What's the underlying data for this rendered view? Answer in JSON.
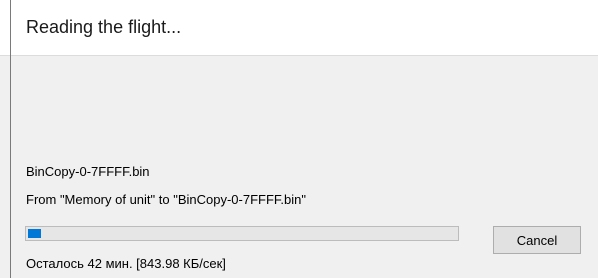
{
  "dialog": {
    "title": "Reading the flight..."
  },
  "status": {
    "file_name": "BinCopy-0-7FFFF.bin",
    "transfer_text": "From \"Memory of unit\" to \"BinCopy-0-7FFFF.bin\"",
    "remaining_text": "Осталось 42 мин. [843.98 КБ/сек]"
  },
  "progress": {
    "fraction": 0.02,
    "color": "#0078d7"
  },
  "buttons": {
    "cancel_label": "Cancel"
  }
}
